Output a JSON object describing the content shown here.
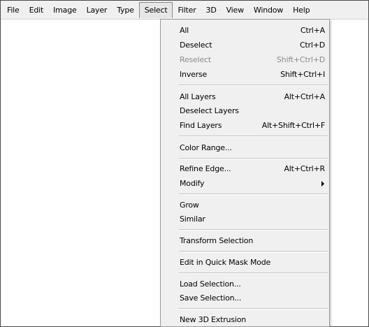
{
  "menubar": {
    "items": [
      "File",
      "Edit",
      "Image",
      "Layer",
      "Type",
      "Select",
      "Filter",
      "3D",
      "View",
      "Window",
      "Help"
    ]
  },
  "select_menu": {
    "items": [
      {
        "label": "All",
        "shortcut": "Ctrl+A"
      },
      {
        "label": "Deselect",
        "shortcut": "Ctrl+D"
      },
      {
        "label": "Reselect",
        "shortcut": "Shift+Ctrl+D",
        "disabled": true
      },
      {
        "label": "Inverse",
        "shortcut": "Shift+Ctrl+I"
      },
      {
        "label": "All Layers",
        "shortcut": "Alt+Ctrl+A"
      },
      {
        "label": "Deselect Layers",
        "shortcut": ""
      },
      {
        "label": "Find Layers",
        "shortcut": "Alt+Shift+Ctrl+F"
      },
      {
        "label": "Color Range...",
        "shortcut": ""
      },
      {
        "label": "Refine Edge...",
        "shortcut": "Alt+Ctrl+R"
      },
      {
        "label": "Modify",
        "shortcut": "",
        "submenu": true
      },
      {
        "label": "Grow",
        "shortcut": ""
      },
      {
        "label": "Similar",
        "shortcut": ""
      },
      {
        "label": "Transform Selection",
        "shortcut": ""
      },
      {
        "label": "Edit in Quick Mask Mode",
        "shortcut": ""
      },
      {
        "label": "Load Selection...",
        "shortcut": ""
      },
      {
        "label": "Save Selection...",
        "shortcut": ""
      },
      {
        "label": "New 3D Extrusion",
        "shortcut": ""
      }
    ]
  }
}
